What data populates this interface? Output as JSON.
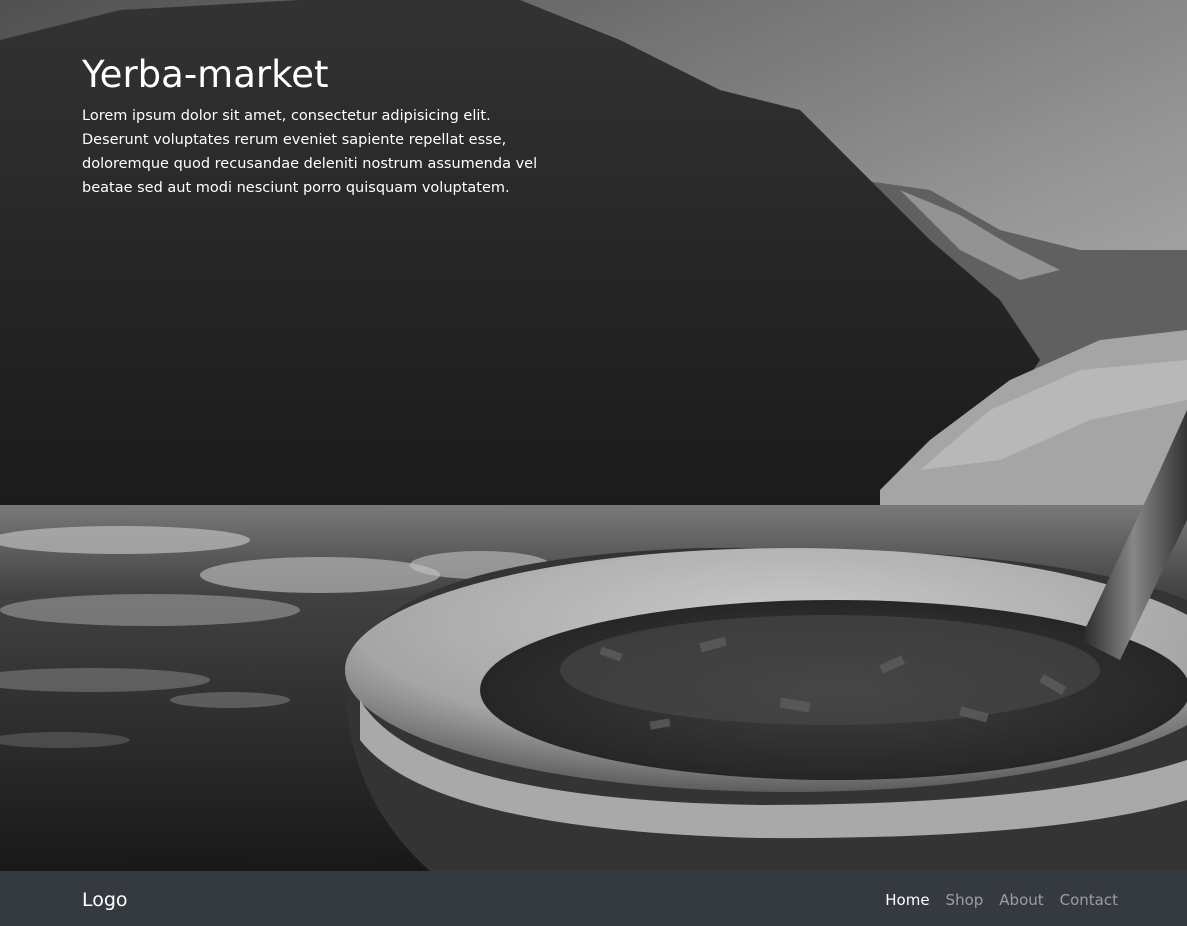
{
  "hero": {
    "title": "Yerba-market",
    "description": "Lorem ipsum dolor sit amet, consectetur adipisicing elit. Deserunt voluptates rerum eveniet sapiente repellat esse, doloremque quod recusandae deleniti nostrum assumenda vel beatae sed aut modi nesciunt porro quisquam voluptatem."
  },
  "navbar": {
    "brand": "Logo",
    "links": [
      {
        "label": "Home",
        "active": true
      },
      {
        "label": "Shop",
        "active": false
      },
      {
        "label": "About",
        "active": false
      },
      {
        "label": "Contact",
        "active": false
      }
    ],
    "background": "#343a40"
  },
  "background_image": {
    "subject": "black-and-white photo of a mate gourd with yerba leaves and bombilla in front of mountains and icy water"
  }
}
